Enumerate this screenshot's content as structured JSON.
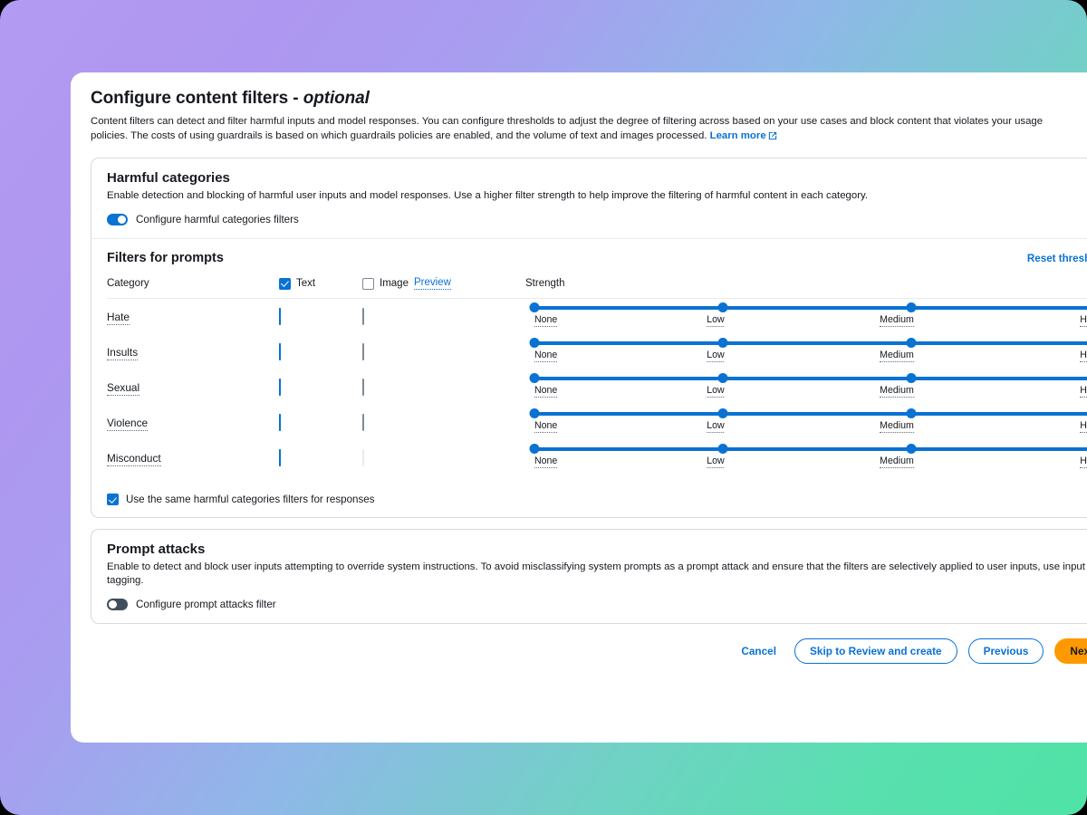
{
  "page": {
    "title_main": "Configure content filters - ",
    "title_optional": "optional",
    "description": "Content filters can detect and filter harmful inputs and model responses. You can configure thresholds to adjust the degree of filtering across based on your use cases and block content that violates your usage policies. The costs of using guardrails is based on which guardrails policies are enabled, and the volume of text and images processed.",
    "learn_more": "Learn more",
    "external_link_icon": "external-link-icon"
  },
  "harmful": {
    "title": "Harmful categories",
    "description": "Enable detection and blocking of harmful user inputs and model responses. Use a higher filter strength to help improve the filtering of harmful content in each category.",
    "toggle_label": "Configure harmful categories filters",
    "toggle_state": "on",
    "filters_title": "Filters for prompts",
    "reset_label": "Reset thresholds",
    "columns": {
      "category": "Category",
      "text": "Text",
      "image": "Image",
      "image_badge": "Preview",
      "strength": "Strength"
    },
    "header_text_checked": true,
    "header_image_checked": false,
    "tick_labels": [
      "None",
      "Low",
      "Medium",
      "High"
    ],
    "rows": [
      {
        "category": "Hate",
        "text_checked": true,
        "image_checked": false,
        "image_disabled": false,
        "strength": "High"
      },
      {
        "category": "Insults",
        "text_checked": true,
        "image_checked": false,
        "image_disabled": false,
        "strength": "High"
      },
      {
        "category": "Sexual",
        "text_checked": true,
        "image_checked": false,
        "image_disabled": false,
        "strength": "High"
      },
      {
        "category": "Violence",
        "text_checked": true,
        "image_checked": false,
        "image_disabled": false,
        "strength": "High"
      },
      {
        "category": "Misconduct",
        "text_checked": true,
        "image_checked": false,
        "image_disabled": true,
        "strength": "High"
      }
    ],
    "use_same_label": "Use the same harmful categories filters for responses",
    "use_same_checked": true
  },
  "prompt_attacks": {
    "title": "Prompt attacks",
    "description": "Enable to detect and block user inputs attempting to override system instructions. To avoid misclassifying system prompts as a prompt attack and ensure that the filters are selectively applied to user inputs, use input tagging.",
    "toggle_label": "Configure prompt attacks filter",
    "toggle_state": "off"
  },
  "footer": {
    "cancel": "Cancel",
    "skip": "Skip to Review and create",
    "previous": "Previous",
    "next": "Next"
  },
  "colors": {
    "accent_blue": "#0972d3",
    "primary_orange": "#ff9900",
    "text_dark": "#16191f",
    "border_grey": "#d5dbdb",
    "toggle_off": "#414d5c"
  },
  "chart_data": null
}
